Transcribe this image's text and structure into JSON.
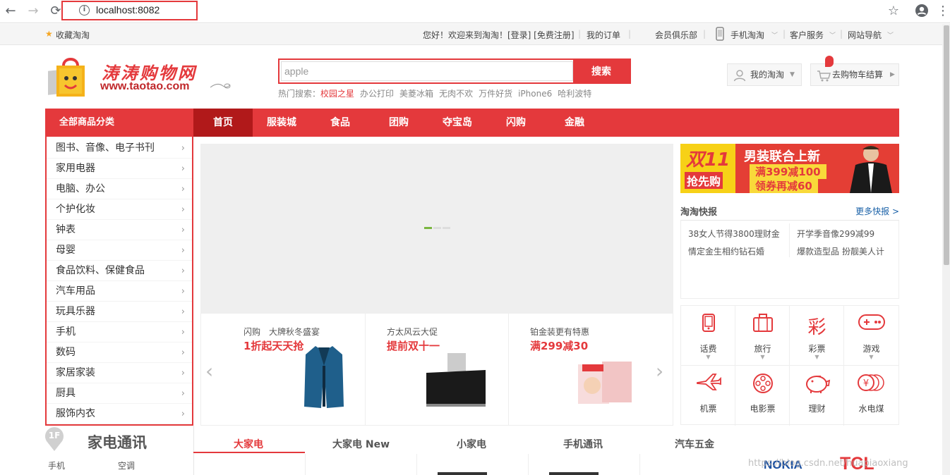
{
  "browser": {
    "url": "localhost:8082",
    "back_icon": "←",
    "forward_icon": "→",
    "reload_icon": "⟳",
    "star_icon": "☆",
    "menu_icon": "⋮"
  },
  "topbar": {
    "favorite": "收藏淘淘",
    "welcome": "您好！欢迎来到淘淘！[登录] [免费注册]",
    "orders": "我的订单",
    "club": "会员俱乐部",
    "mobile": "手机淘淘",
    "service": "客户服务",
    "sitenav": "网站导航"
  },
  "header": {
    "logo_cn": "涛涛购物网",
    "logo_en": "www.taotao.com",
    "search_value": "apple",
    "search_button": "搜索",
    "hot_label": "热门搜索：",
    "hot_items": [
      "校园之星",
      "办公打印",
      "美菱冰箱",
      "无肉不欢",
      "万件好货",
      "iPhone6",
      "哈利波特"
    ],
    "my_account": "我的淘淘",
    "cart": "去购物车结算"
  },
  "nav": {
    "all_categories": "全部商品分类",
    "items": [
      "首页",
      "服装城",
      "食品",
      "团购",
      "夺宝岛",
      "闪购",
      "金融"
    ]
  },
  "categories": [
    "图书、音像、电子书刊",
    "家用电器",
    "电脑、办公",
    "个护化妆",
    "钟表",
    "母婴",
    "食品饮料、保健食品",
    "汽车用品",
    "玩具乐器",
    "手机",
    "数码",
    "家居家装",
    "厨具",
    "服饰内衣"
  ],
  "promos": [
    {
      "title": "闪购　大牌秋冬盛宴",
      "sub": "1折起天天抢"
    },
    {
      "title": "方太风云大促",
      "sub": "提前双十一"
    },
    {
      "title": "铂金装更有特惠",
      "sub": "满299减30"
    }
  ],
  "ad": {
    "left_big": "双11",
    "left_small": "抢先购",
    "title": "男装联合上新",
    "line1": "满399减100",
    "line2": "领券再减60"
  },
  "news": {
    "title": "淘淘快报",
    "more": "更多快报 >",
    "items": [
      "38女人节得3800理财金",
      "开学季音像299减99",
      "情定金生相约钻石婚",
      "爆款造型品 扮靓美人计"
    ]
  },
  "services": [
    {
      "label": "话费",
      "icon": "phone-icon",
      "glyph": "▯"
    },
    {
      "label": "旅行",
      "icon": "suitcase-icon",
      "glyph": "⛋"
    },
    {
      "label": "彩票",
      "icon": "lottery-icon",
      "glyph": "彩"
    },
    {
      "label": "游戏",
      "icon": "gamepad-icon",
      "glyph": "⊕"
    },
    {
      "label": "机票",
      "icon": "airplane-icon",
      "glyph": "✈"
    },
    {
      "label": "电影票",
      "icon": "film-icon",
      "glyph": "⊛"
    },
    {
      "label": "理财",
      "icon": "piggy-bank-icon",
      "glyph": "♉"
    },
    {
      "label": "水电煤",
      "icon": "utility-icon",
      "glyph": "¥"
    }
  ],
  "floor": {
    "badge": "1F",
    "title": "家电通讯",
    "sub_links": [
      "手机",
      "空调"
    ],
    "tabs": [
      "大家电",
      "大家电 New",
      "小家电",
      "手机通讯",
      "汽车五金"
    ],
    "brands": [
      "NOKIA",
      "TCL"
    ],
    "watermark": "https://blog.csdn.net/huapiaoxiang"
  },
  "colors": {
    "accent": "#e4393c",
    "nav_active": "#b1191a",
    "link_blue": "#1960a7"
  }
}
